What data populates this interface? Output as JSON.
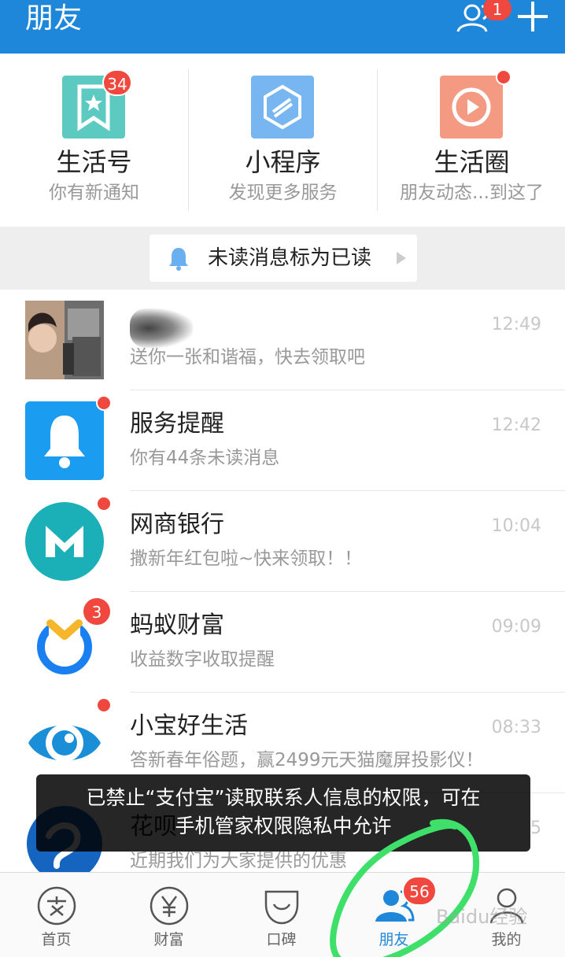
{
  "header": {
    "title": "朋友",
    "contacts_icon": "contacts-icon",
    "contacts_badge": "1",
    "add_icon": "plus-icon",
    "bg_color": "#1f87d9"
  },
  "top_cards": [
    {
      "title": "生活号",
      "subtitle": "你有新通知",
      "icon": "bookmark-star-icon",
      "icon_color": "#5ccac1",
      "badge": "34"
    },
    {
      "title": "小程序",
      "subtitle": "发现更多服务",
      "icon": "mini-program-icon",
      "icon_color": "#77b6f0"
    },
    {
      "title": "生活圈",
      "subtitle": "朋友动态...到这了",
      "icon": "life-circle-icon",
      "icon_color": "#f59a82",
      "dot": true
    }
  ],
  "mark_read": {
    "label": "未读消息标为已读",
    "icon": "bell-icon"
  },
  "messages": [
    {
      "name": "",
      "time": "12:49",
      "preview": "送你一张和谐福，快去领取吧",
      "avatar": "photo-avatar"
    },
    {
      "name": "服务提醒",
      "time": "12:42",
      "preview": "你有44条未读消息",
      "avatar": "bell-avatar",
      "dot": true
    },
    {
      "name": "网商银行",
      "time": "10:04",
      "preview": "撒新年红包啦~快来领取！！",
      "avatar": "mybank-logo",
      "dot": true
    },
    {
      "name": "蚂蚁财富",
      "time": "09:09",
      "preview": "收益数字收取提醒",
      "avatar": "ant-fortune-logo",
      "badge": "3"
    },
    {
      "name": "小宝好生活",
      "time": "08:33",
      "preview": "答新春年俗题，赢2499元天猫魔屏投影仪！",
      "avatar": "eye-logo",
      "dot": true
    },
    {
      "name": "花呗",
      "time": "5",
      "preview": "近期我们为大家提供的优惠",
      "avatar": "huabei-logo"
    }
  ],
  "toast": {
    "line1": "已禁止“支付宝”读取联系人信息的权限，可在",
    "line2": "手机管家权限隐私中允许"
  },
  "tabs": [
    {
      "label": "首页",
      "icon": "home-icon"
    },
    {
      "label": "财富",
      "icon": "yen-icon"
    },
    {
      "label": "口碑",
      "icon": "koubei-icon"
    },
    {
      "label": "朋友",
      "icon": "friends-icon",
      "active": true,
      "badge": "56"
    },
    {
      "label": "我的",
      "icon": "profile-icon"
    }
  ],
  "watermark": "Baidu经验"
}
